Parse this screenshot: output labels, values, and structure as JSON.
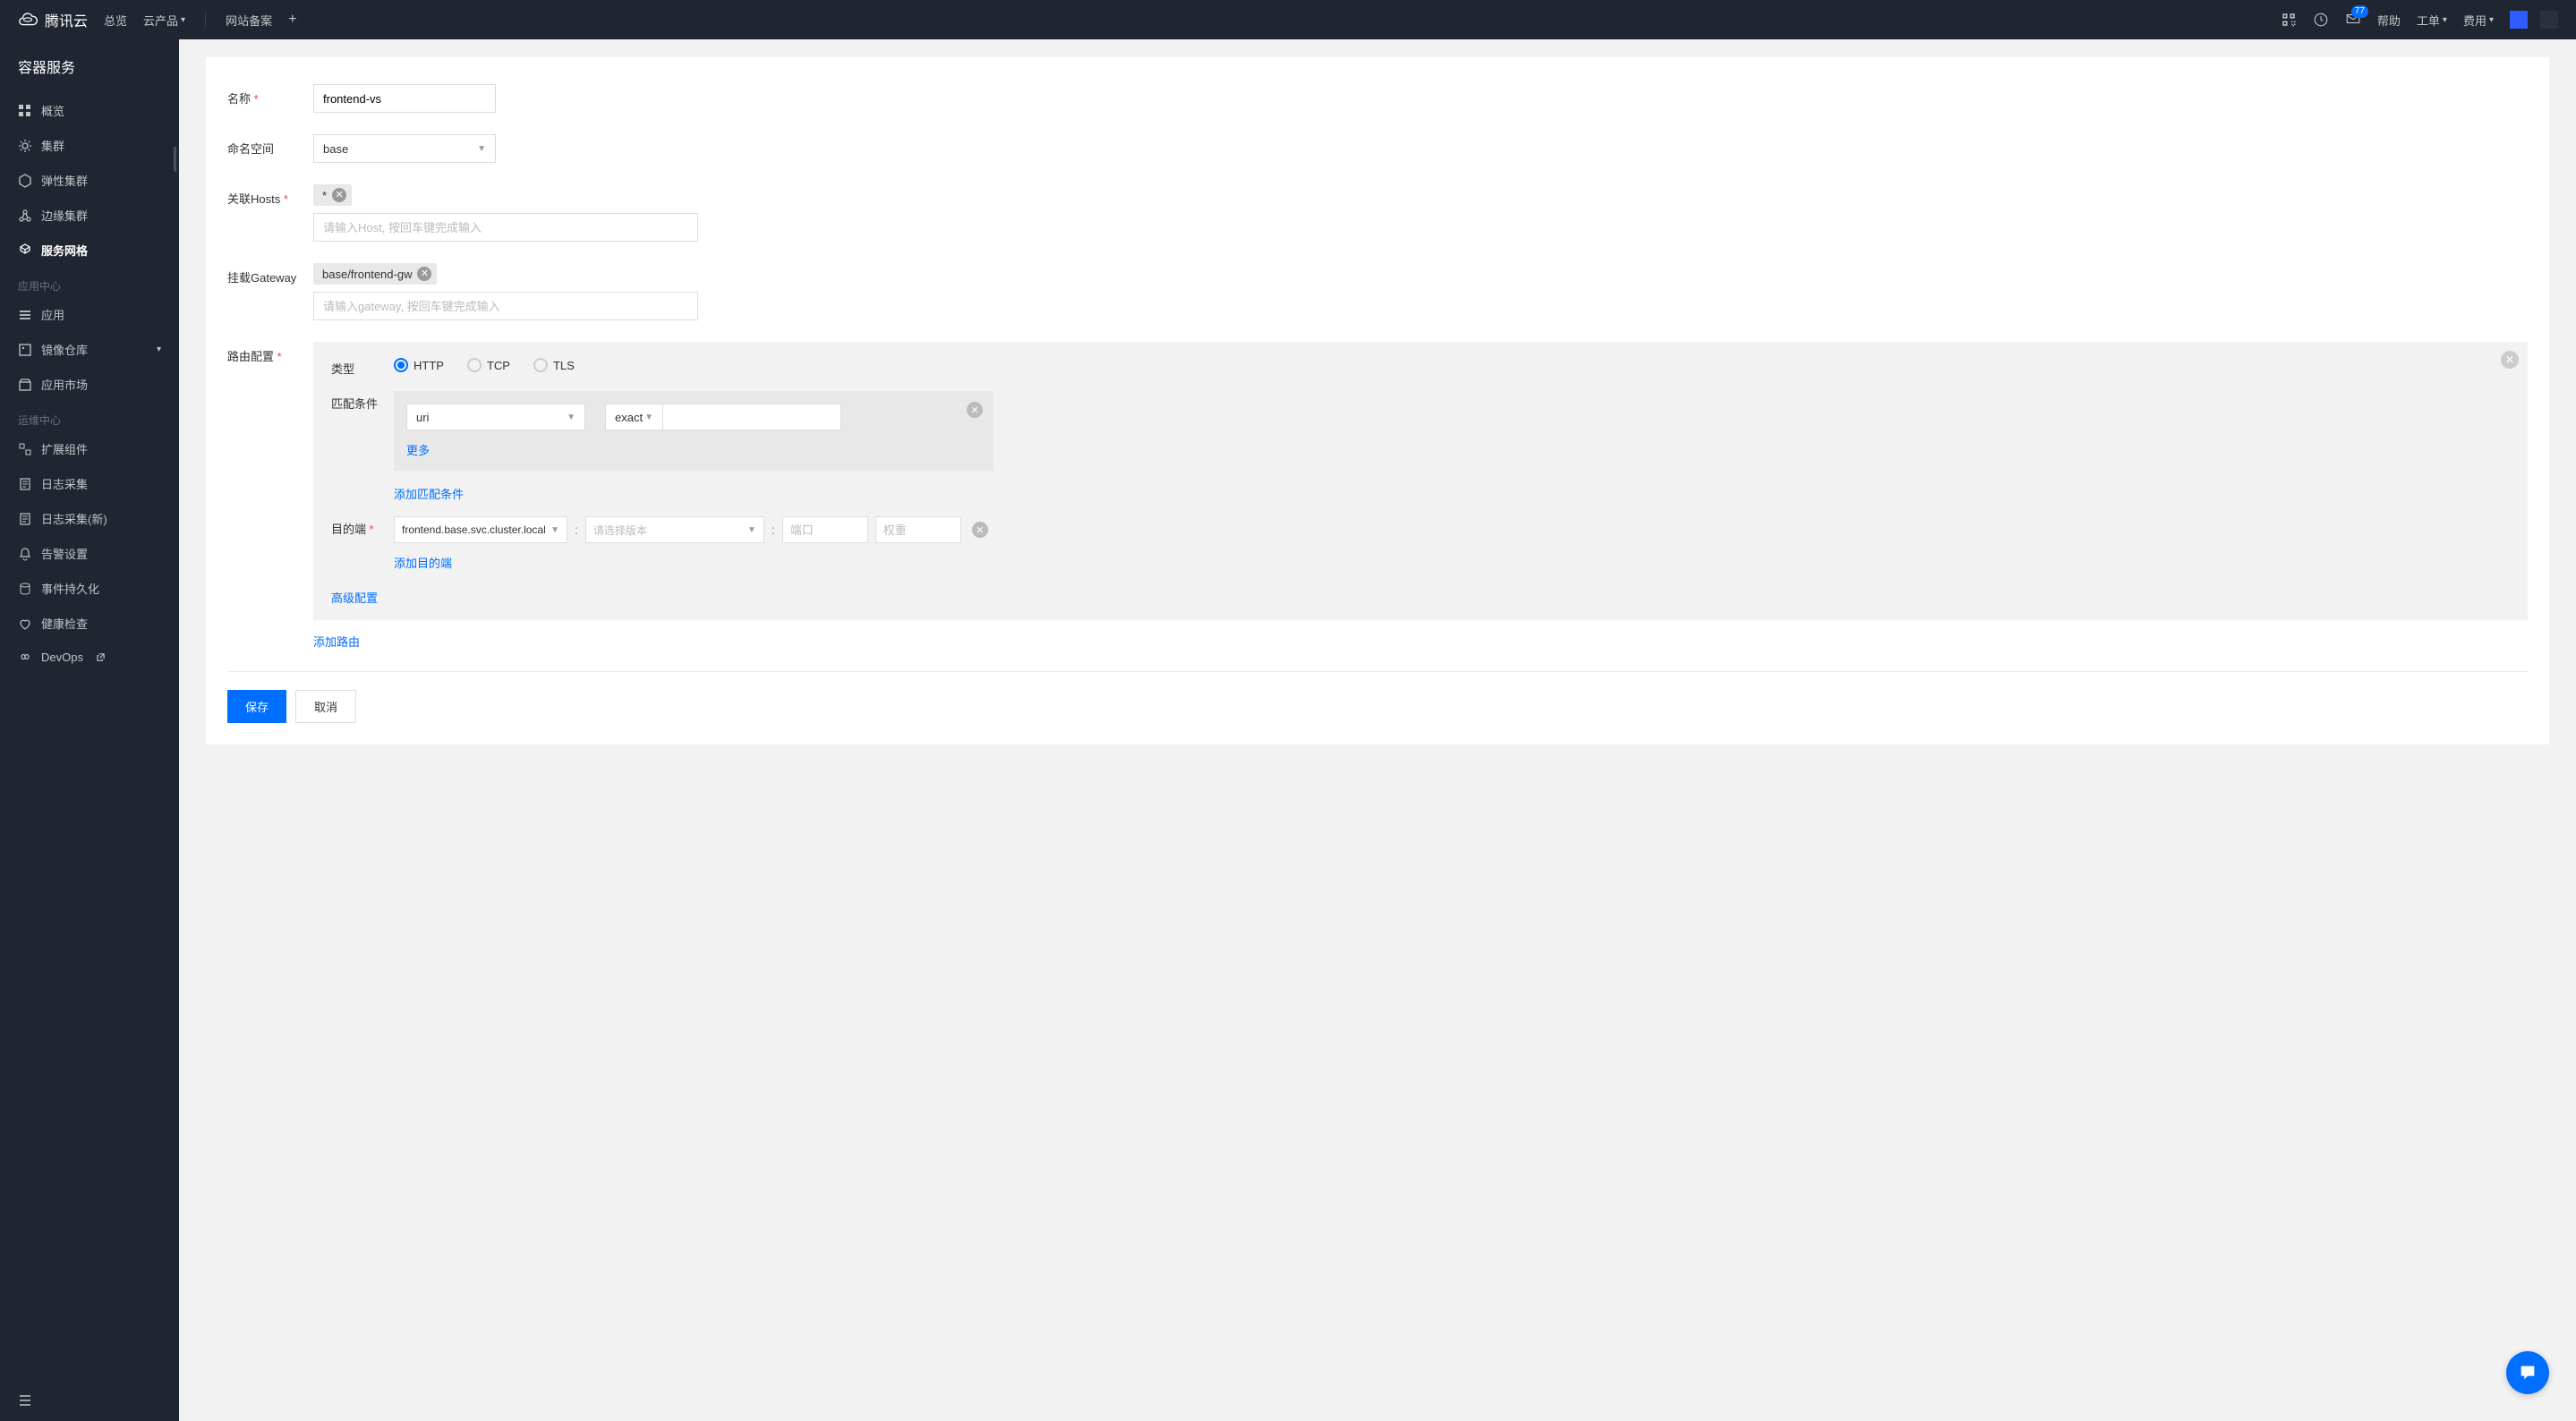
{
  "brand": "腾讯云",
  "topNav": {
    "overview": "总览",
    "products": "云产品",
    "beian": "网站备案",
    "help": "帮助",
    "workorder": "工单",
    "cost": "费用",
    "mailBadge": "77"
  },
  "sidebar": {
    "title": "容器服务",
    "items": {
      "overview": "概览",
      "cluster": "集群",
      "elastic": "弹性集群",
      "edge": "边缘集群",
      "mesh": "服务网格"
    },
    "appCenter": "应用中心",
    "appItems": {
      "app": "应用",
      "registry": "镜像仓库",
      "market": "应用市场"
    },
    "opsCenter": "运维中心",
    "opsItems": {
      "ext": "扩展组件",
      "log": "日志采集",
      "logNew": "日志采集(新)",
      "alarm": "告警设置",
      "event": "事件持久化",
      "health": "健康检查",
      "devops": "DevOps"
    }
  },
  "form": {
    "nameLabel": "名称",
    "nameValue": "frontend-vs",
    "nsLabel": "命名空间",
    "nsValue": "base",
    "hostsLabel": "关联Hosts",
    "hostTag": "*",
    "hostPlaceholder": "请输入Host, 按回车键完成输入",
    "gwLabel": "挂载Gateway",
    "gwTag": "base/frontend-gw",
    "gwPlaceholder": "请输入gateway, 按回车键完成输入",
    "routeLabel": "路由配置",
    "typeLabel": "类型",
    "typeHttp": "HTTP",
    "typeTcp": "TCP",
    "typeTls": "TLS",
    "matchLabel": "匹配条件",
    "matchField": "uri",
    "matchOp": "exact",
    "moreLink": "更多",
    "addMatch": "添加匹配条件",
    "destLabel": "目的端",
    "destService": "frontend.base.svc.cluster.local",
    "destVersion": "请选择版本",
    "destPort": "端口",
    "destWeight": "权重",
    "addDest": "添加目的端",
    "advanced": "高级配置",
    "addRoute": "添加路由",
    "save": "保存",
    "cancel": "取消"
  }
}
